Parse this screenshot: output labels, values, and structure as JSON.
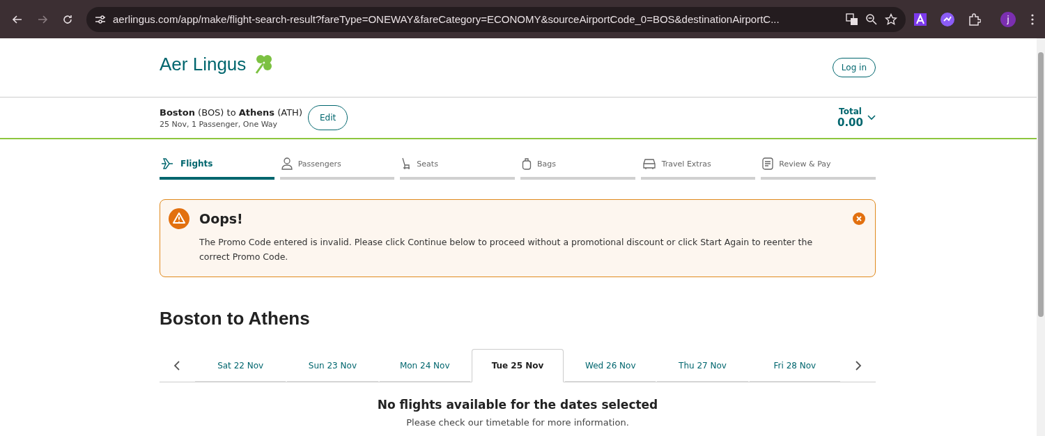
{
  "browser": {
    "url": "aerlingus.com/app/make/flight-search-result?fareType=ONEWAY&fareCategory=ECONOMY&sourceAirportCode_0=BOS&destinationAirportC...",
    "avatar": "j"
  },
  "header": {
    "logo": "Aer Lingus",
    "login": "Log in"
  },
  "trip": {
    "route": "**Boston** (BOS) to **Athens** (ATH)",
    "details": "25 Nov, 1 Passenger, One Way",
    "edit": "Edit",
    "total_label": "Total",
    "total": "0.00"
  },
  "steps": [
    {
      "label": "Flights",
      "kind": "plane",
      "selected": true
    },
    {
      "label": "Passengers",
      "kind": "person",
      "selected": false
    },
    {
      "label": "Seats",
      "kind": "seat",
      "selected": false
    },
    {
      "label": "Bags",
      "kind": "bag",
      "selected": false
    },
    {
      "label": "Travel Extras",
      "kind": "car",
      "selected": false
    },
    {
      "label": "Review & Pay",
      "kind": "list",
      "selected": false
    }
  ],
  "alert": {
    "title": "Oops!",
    "message": "The Promo Code entered is invalid. Please click Continue below to proceed without a promotional discount or click Start Again to reenter the correct Promo Code."
  },
  "heading": "Boston to Athens",
  "dates": [
    {
      "label": "Sat 22 Nov",
      "selected": false
    },
    {
      "label": "Sun 23 Nov",
      "selected": false
    },
    {
      "label": "Mon 24 Nov",
      "selected": false
    },
    {
      "label": "Tue 25 Nov",
      "selected": true
    },
    {
      "label": "Wed 26 Nov",
      "selected": false
    },
    {
      "label": "Thu 27 Nov",
      "selected": false
    },
    {
      "label": "Fri 28 Nov",
      "selected": false
    }
  ],
  "empty": {
    "title": "No flights available for the dates selected",
    "message": "Please check our timetable for more information."
  }
}
